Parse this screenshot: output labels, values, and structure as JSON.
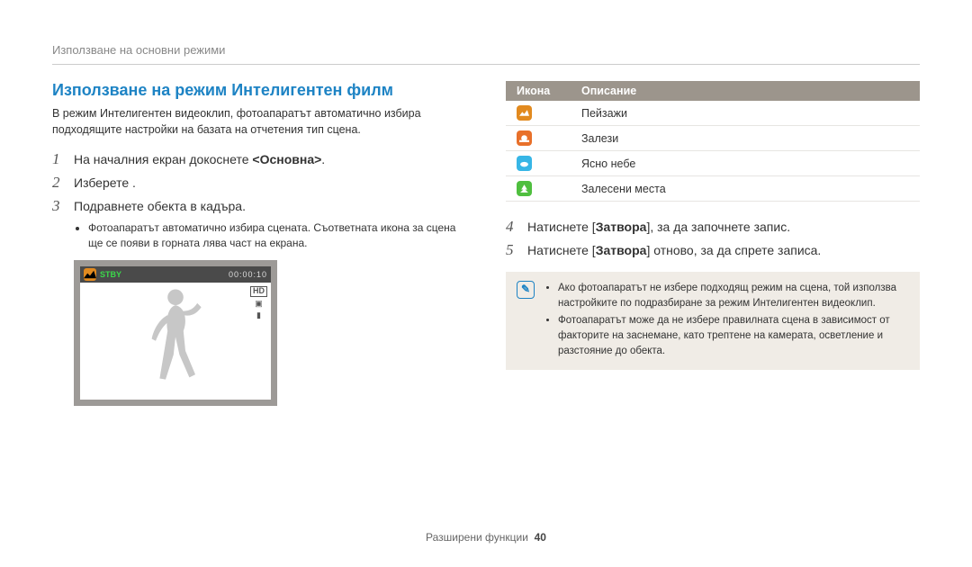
{
  "running_header": "Използване на основни режими",
  "section_title": "Използване на режим Интелигентен филм",
  "intro": "В режим Интелигентен видеоклип, фотоапаратът автоматично избира подходящите настройки на базата на отчетения тип сцена.",
  "steps": {
    "s1_pre": "На началния екран докоснете ",
    "s1_bold": "<Основна>",
    "s1_post": ".",
    "s2": "Изберете       .",
    "s3": "Подравнете обекта в кадъра.",
    "s3_sub": "Фотоапаратът автоматично избира сцената. Съответната икона за сцена ще се появи в горната лява част на екрана.",
    "s4_pre": "Натиснете [",
    "s4_bold": "Затвора",
    "s4_post": "], за да започнете запис.",
    "s5_pre": "Натиснете [",
    "s5_bold": "Затвора",
    "s5_post": "] отново, за да спрете записа."
  },
  "preview": {
    "stby": "STBY",
    "timer": "00:00:10",
    "hd": "HD"
  },
  "table": {
    "col_icon": "Икона",
    "col_desc": "Описание",
    "rows": [
      {
        "icon_class": "bg-orange",
        "name": "landscape-icon",
        "label": "Пейзажи"
      },
      {
        "icon_class": "bg-orange2",
        "name": "sunset-icon",
        "label": "Залези"
      },
      {
        "icon_class": "bg-cyan",
        "name": "clear-sky-icon",
        "label": "Ясно небе"
      },
      {
        "icon_class": "bg-green",
        "name": "forest-icon",
        "label": "Залесени места"
      }
    ]
  },
  "note": {
    "b1": "Ако фотоапаратът не избере подходящ режим на сцена, той използва настройките по подразбиране за режим Интелигентен видеоклип.",
    "b2": "Фотоапаратът може да не избере правилната сцена в зависимост от факторите на заснемане, като трептене на камерата, осветление и разстояние до обекта."
  },
  "footer_label": "Разширени функции",
  "footer_page": "40"
}
